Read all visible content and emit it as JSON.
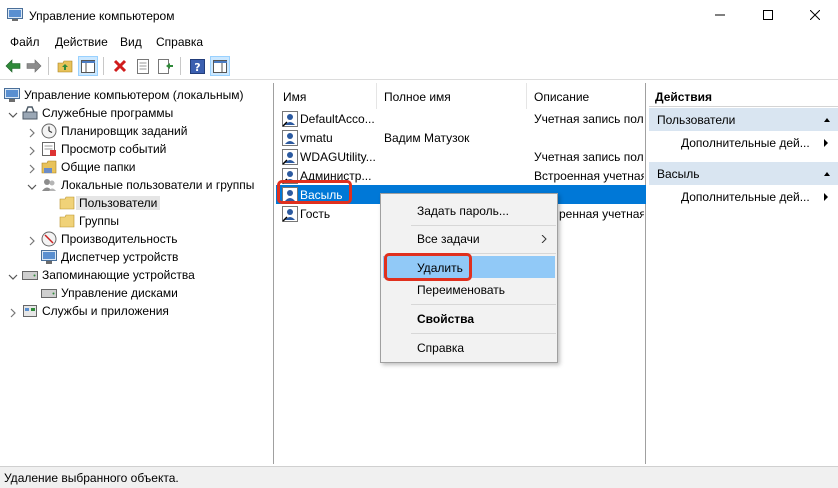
{
  "window": {
    "title": "Управление компьютером"
  },
  "menu": [
    "Файл",
    "Действие",
    "Вид",
    "Справка"
  ],
  "toolbar": {
    "buttons": [
      "back-arrow-icon",
      "forward-arrow-icon",
      "up-folder-icon",
      "show-hide-tree-icon",
      "delete-icon",
      "properties-icon",
      "export-icon",
      "help-icon",
      "show-hide-action-pane-icon"
    ]
  },
  "tree": {
    "root": "Управление компьютером (локальным)",
    "system_tools": "Служебные программы",
    "task_scheduler": "Планировщик заданий",
    "event_viewer": "Просмотр событий",
    "shared_folders": "Общие папки",
    "local_users": "Локальные пользователи и группы",
    "users": "Пользователи",
    "groups": "Группы",
    "performance": "Производительность",
    "device_manager": "Диспетчер устройств",
    "storage": "Запоминающие устройства",
    "disk_management": "Управление дисками",
    "services": "Службы и приложения"
  },
  "list": {
    "columns": [
      "Имя",
      "Полное имя",
      "Описание"
    ],
    "rows": [
      {
        "name": "DefaultAcco...",
        "full_name": "",
        "description": "Учетная запись пол"
      },
      {
        "name": "vmatu",
        "full_name": "Вадим Матузок",
        "description": ""
      },
      {
        "name": "WDAGUtility...",
        "full_name": "",
        "description": "Учетная запись пол"
      },
      {
        "name": "Администр...",
        "full_name": "",
        "description": "Встроенная учетная"
      },
      {
        "name": "Васыль",
        "full_name": "",
        "description": ""
      },
      {
        "name": "Гость",
        "full_name": "",
        "description": "ренная учетная"
      }
    ]
  },
  "actions": {
    "header": "Действия",
    "section1": "Пользователи",
    "section1_item": "Дополнительные дей...",
    "section2": "Васыль",
    "section2_item": "Дополнительные дей..."
  },
  "context_menu": {
    "set_password": "Задать пароль...",
    "all_tasks": "Все задачи",
    "delete": "Удалить",
    "rename": "Переименовать",
    "properties": "Свойства",
    "help": "Справка"
  },
  "status": {
    "text": "Удаление выбранного объекта."
  },
  "colors": {
    "selection": "#0078d7",
    "menu_hover": "#91c9f7",
    "highlight_box": "#e0301e",
    "action_section": "#d9e5f1"
  }
}
